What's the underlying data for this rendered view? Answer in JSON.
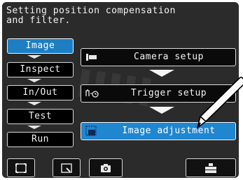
{
  "instruction": "Setting position compensation\nand filter.",
  "menu": {
    "items": [
      {
        "label": "Image",
        "active": true
      },
      {
        "label": "Inspect",
        "active": false
      },
      {
        "label": "In/Out",
        "active": false
      },
      {
        "label": "Test",
        "active": false
      },
      {
        "label": "Run",
        "active": false
      }
    ]
  },
  "flow": {
    "steps": [
      {
        "label": "Camera setup",
        "icon": "camera-setup-icon"
      },
      {
        "label": "Trigger setup",
        "icon": "trigger-setup-icon"
      },
      {
        "label": "Image adjustment",
        "icon": "image-adjustment-icon",
        "selected": true
      }
    ]
  },
  "toolbar": {
    "buttons": [
      {
        "icon": "fit-screen-icon"
      },
      {
        "icon": "zoom-icon"
      },
      {
        "icon": "camera-icon"
      },
      {
        "icon": "tools-icon"
      }
    ]
  },
  "colors": {
    "screen_background": "#2b2b2b",
    "accent_blue": "#1d7ec4",
    "button_border": "#d9d9d9",
    "text": "#f2f2f2"
  }
}
